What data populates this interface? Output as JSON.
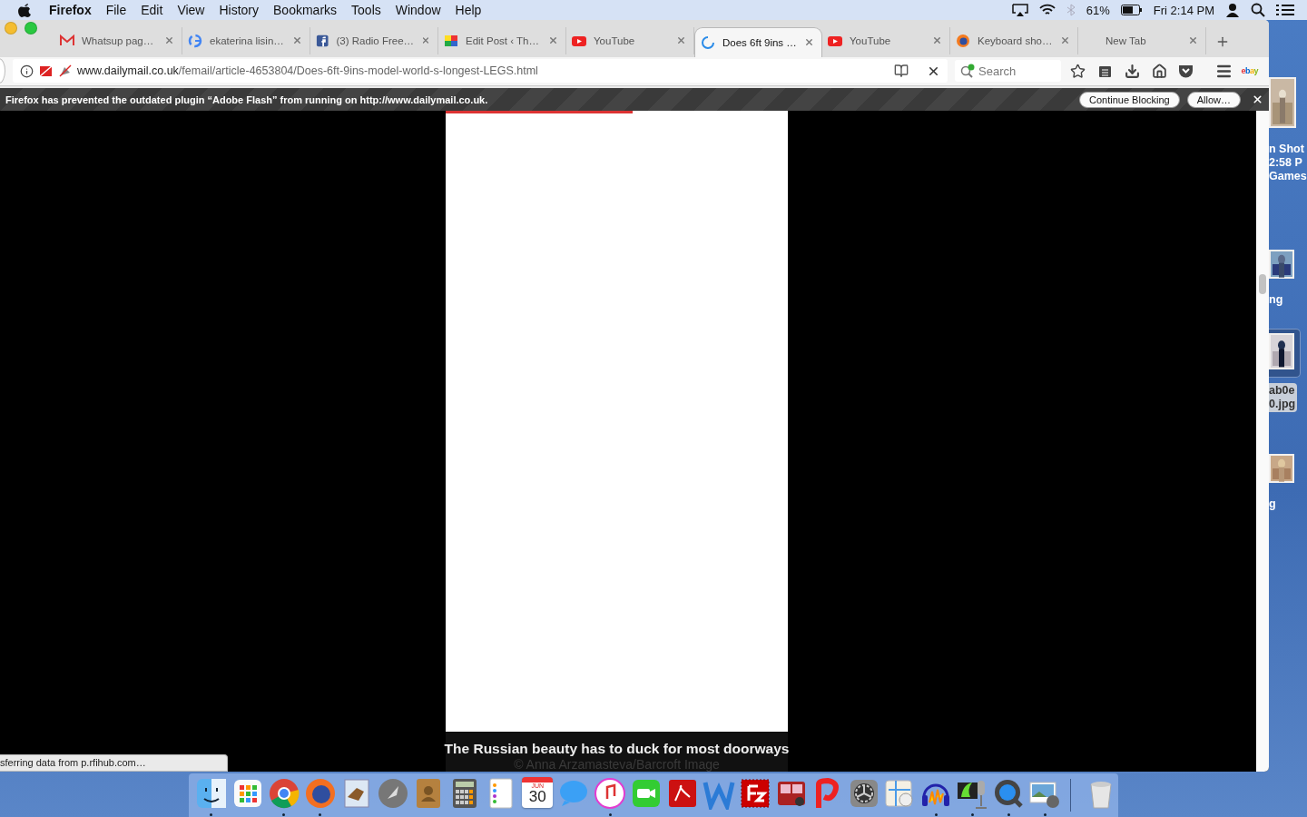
{
  "menu_bar": {
    "app": "Firefox",
    "menus": [
      "File",
      "Edit",
      "View",
      "History",
      "Bookmarks",
      "Tools",
      "Window",
      "Help"
    ],
    "battery": "61%",
    "clock": "Fri 2:14 PM"
  },
  "tabs": [
    {
      "title": "Whatsup pag…",
      "kind": "gmail",
      "selected": false
    },
    {
      "title": "ekaterina lisin…",
      "kind": "google",
      "selected": false
    },
    {
      "title": "(3) Radio Free…",
      "kind": "facebook",
      "selected": false
    },
    {
      "title": "Edit Post ‹ Th…",
      "kind": "rfp",
      "selected": false
    },
    {
      "title": "YouTube",
      "kind": "youtube",
      "selected": false
    },
    {
      "title": "Does 6ft 9ins …",
      "kind": "loading",
      "selected": true
    },
    {
      "title": "YouTube",
      "kind": "youtube",
      "selected": false
    },
    {
      "title": "Keyboard sho…",
      "kind": "firefox",
      "selected": false
    },
    {
      "title": "New Tab",
      "kind": "none",
      "selected": false
    }
  ],
  "address_bar": {
    "host": "www.dailymail.co.uk",
    "path": "/femail/article-4653804/Does-6ft-9ins-model-world-s-longest-LEGS.html"
  },
  "search": {
    "placeholder": "Search"
  },
  "toolbar_logo": "ebay",
  "plugin_bar": {
    "message": "Firefox has prevented the outdated plugin “Adobe Flash” from running on http://www.dailymail.co.uk.",
    "buttons": [
      "Continue Blocking",
      "Allow…"
    ]
  },
  "caption": "The Russian beauty has to duck for most doorways",
  "credit": "© Anna Arzamasteva/Barcroft Image",
  "status": "sferring data from p.rfihub.com…",
  "desktop_items": [
    {
      "lines": [
        "n Shot",
        "2:58 P",
        "Games"
      ],
      "selected": false
    },
    {
      "lines": [
        "ng"
      ],
      "selected": false
    },
    {
      "lines": [
        "ab0e",
        "0.jpg"
      ],
      "selected": true
    },
    {
      "lines": [
        "g"
      ],
      "selected": false
    }
  ],
  "calendar": {
    "month": "JUN",
    "day": "30"
  },
  "dock": [
    {
      "running": true
    },
    {
      "running": false
    },
    {
      "running": true
    },
    {
      "running": true
    },
    {
      "running": false
    },
    {
      "running": false
    },
    {
      "running": false
    },
    {
      "running": false
    },
    {
      "running": false
    },
    {
      "running": false
    },
    {
      "running": false
    },
    {
      "running": true
    },
    {
      "running": false
    },
    {
      "running": false
    },
    {
      "running": false
    },
    {
      "running": false
    },
    {
      "running": false
    },
    {
      "running": false
    },
    {
      "running": false
    },
    {
      "running": false
    },
    {
      "running": true
    },
    {
      "running": true
    },
    {
      "running": true
    },
    {
      "running": true
    },
    {
      "running": false
    }
  ]
}
